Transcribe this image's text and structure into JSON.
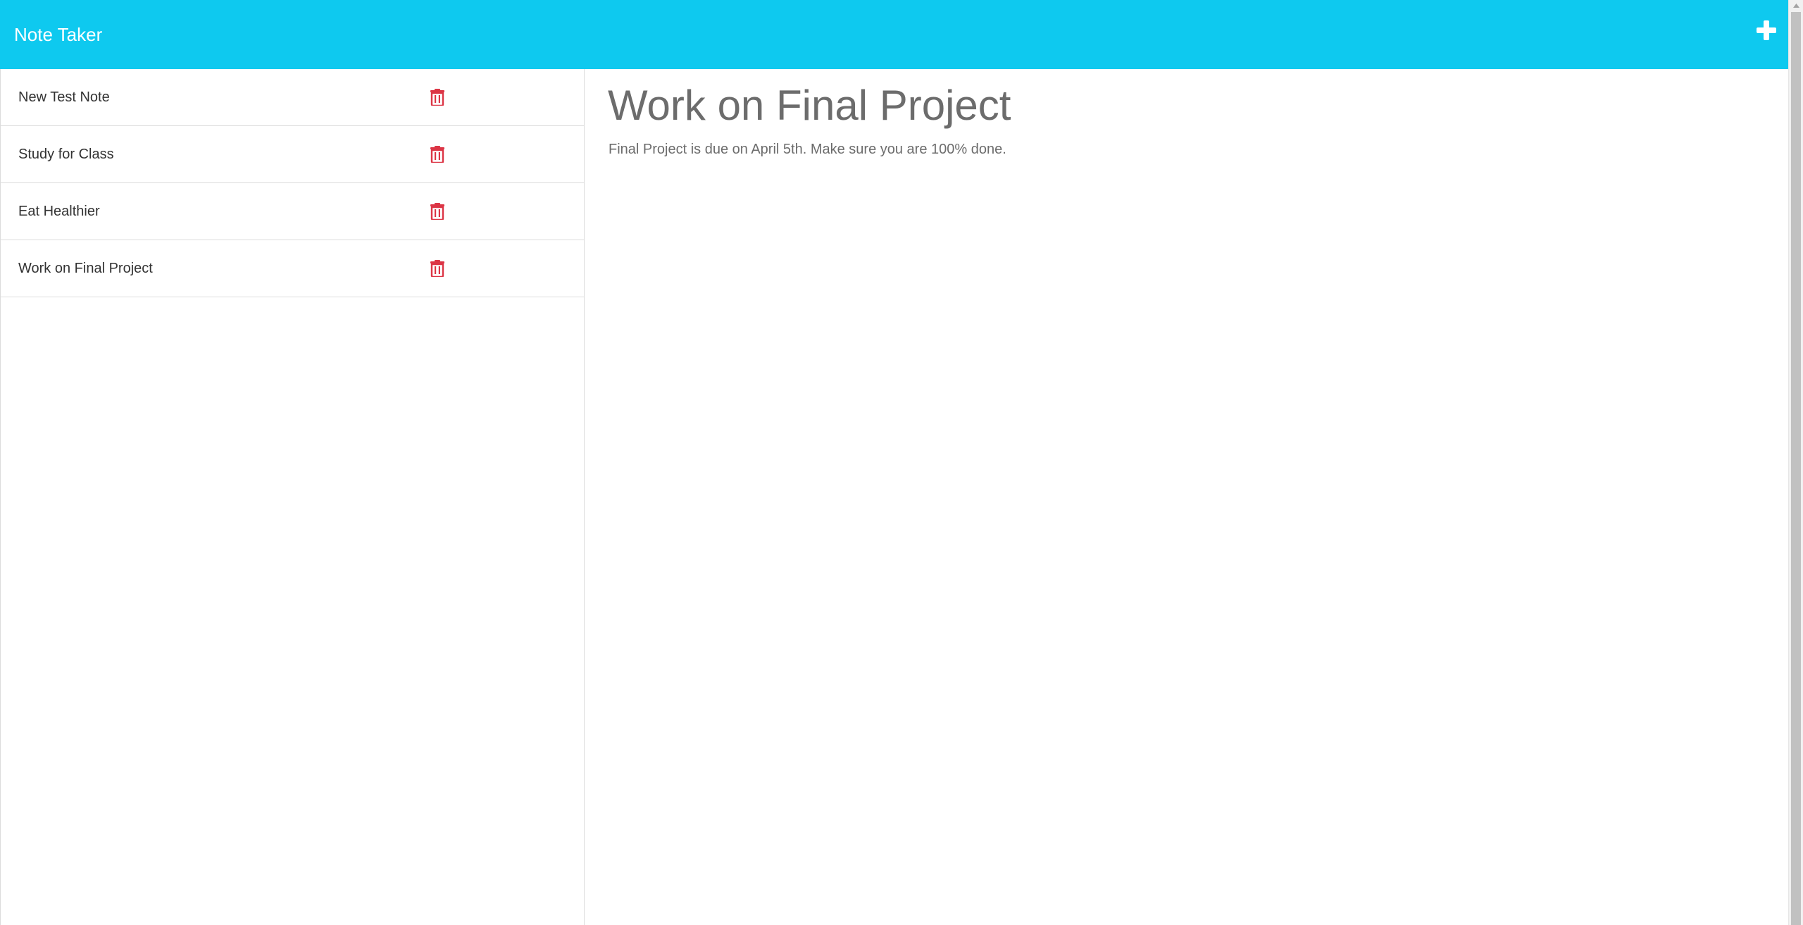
{
  "app": {
    "title": "Note Taker"
  },
  "header": {
    "brand": "Note Taker",
    "add_icon": "plus-icon"
  },
  "sidebar": {
    "notes": [
      {
        "title": "New Test Note",
        "icon": "trash-icon"
      },
      {
        "title": "Study for Class",
        "icon": "trash-icon"
      },
      {
        "title": "Eat Healthier",
        "icon": "trash-icon"
      },
      {
        "title": "Work on Final Project",
        "icon": "trash-icon"
      }
    ]
  },
  "active_note": {
    "title": "Work on Final Project",
    "text": "Final Project is due on April 5th. Make sure you are 100% done."
  },
  "colors": {
    "navbar": "#0ec9ef",
    "delete": "#dc3545",
    "text_muted": "#6c6c6c"
  }
}
